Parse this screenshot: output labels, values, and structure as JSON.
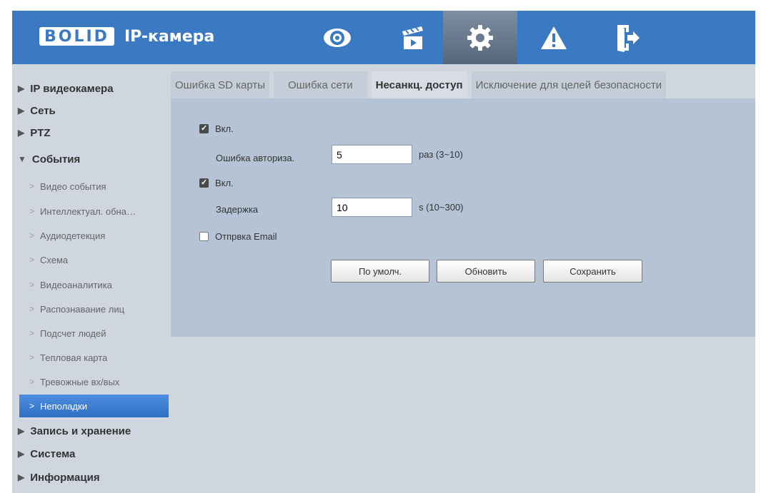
{
  "header": {
    "logo_text": "BOLID",
    "title": "IP-камера",
    "nav_icons": [
      "eye-icon",
      "clapperboard-icon",
      "gear-icon",
      "warning-icon",
      "logout-icon"
    ],
    "active_nav": "gear-icon",
    "bg_color": "#3b79c3"
  },
  "sidebar": {
    "sections_top": [
      {
        "label": "IP видеокамера"
      },
      {
        "label": "Сеть"
      },
      {
        "label": "PTZ"
      }
    ],
    "events_label": "События",
    "events_children": [
      "Видео события",
      "Интеллектуал. обна…",
      "Аудиодетекция",
      "Схема",
      "Видеоаналитика",
      "Распознавание лиц",
      "Подсчет людей",
      "Тепловая карта",
      "Тревожные вх/вых",
      "Неполадки"
    ],
    "active_child": "Неполадки",
    "sections_bottom": [
      {
        "label": "Запись и хранение"
      },
      {
        "label": "Система"
      },
      {
        "label": "Информация"
      }
    ]
  },
  "tabs": [
    "Ошибка SD карты",
    "Ошибка сети",
    "Несанкц. доступ",
    "Исключение для целей безопасности"
  ],
  "active_tab": "Несанкц. доступ",
  "form": {
    "enable1_label": "Вкл.",
    "enable1_checked": true,
    "login_error_label": "Ошибка авториза.",
    "login_error_value": "5",
    "login_error_unit": "раз (3~10)",
    "enable2_label": "Вкл.",
    "enable2_checked": true,
    "delay_label": "Задержка",
    "delay_value": "10",
    "delay_unit": "s (10~300)",
    "email_label": "Отпрвка Email",
    "email_checked": false
  },
  "buttons": {
    "default": "По умолч.",
    "refresh": "Обновить",
    "save": "Сохранить"
  }
}
